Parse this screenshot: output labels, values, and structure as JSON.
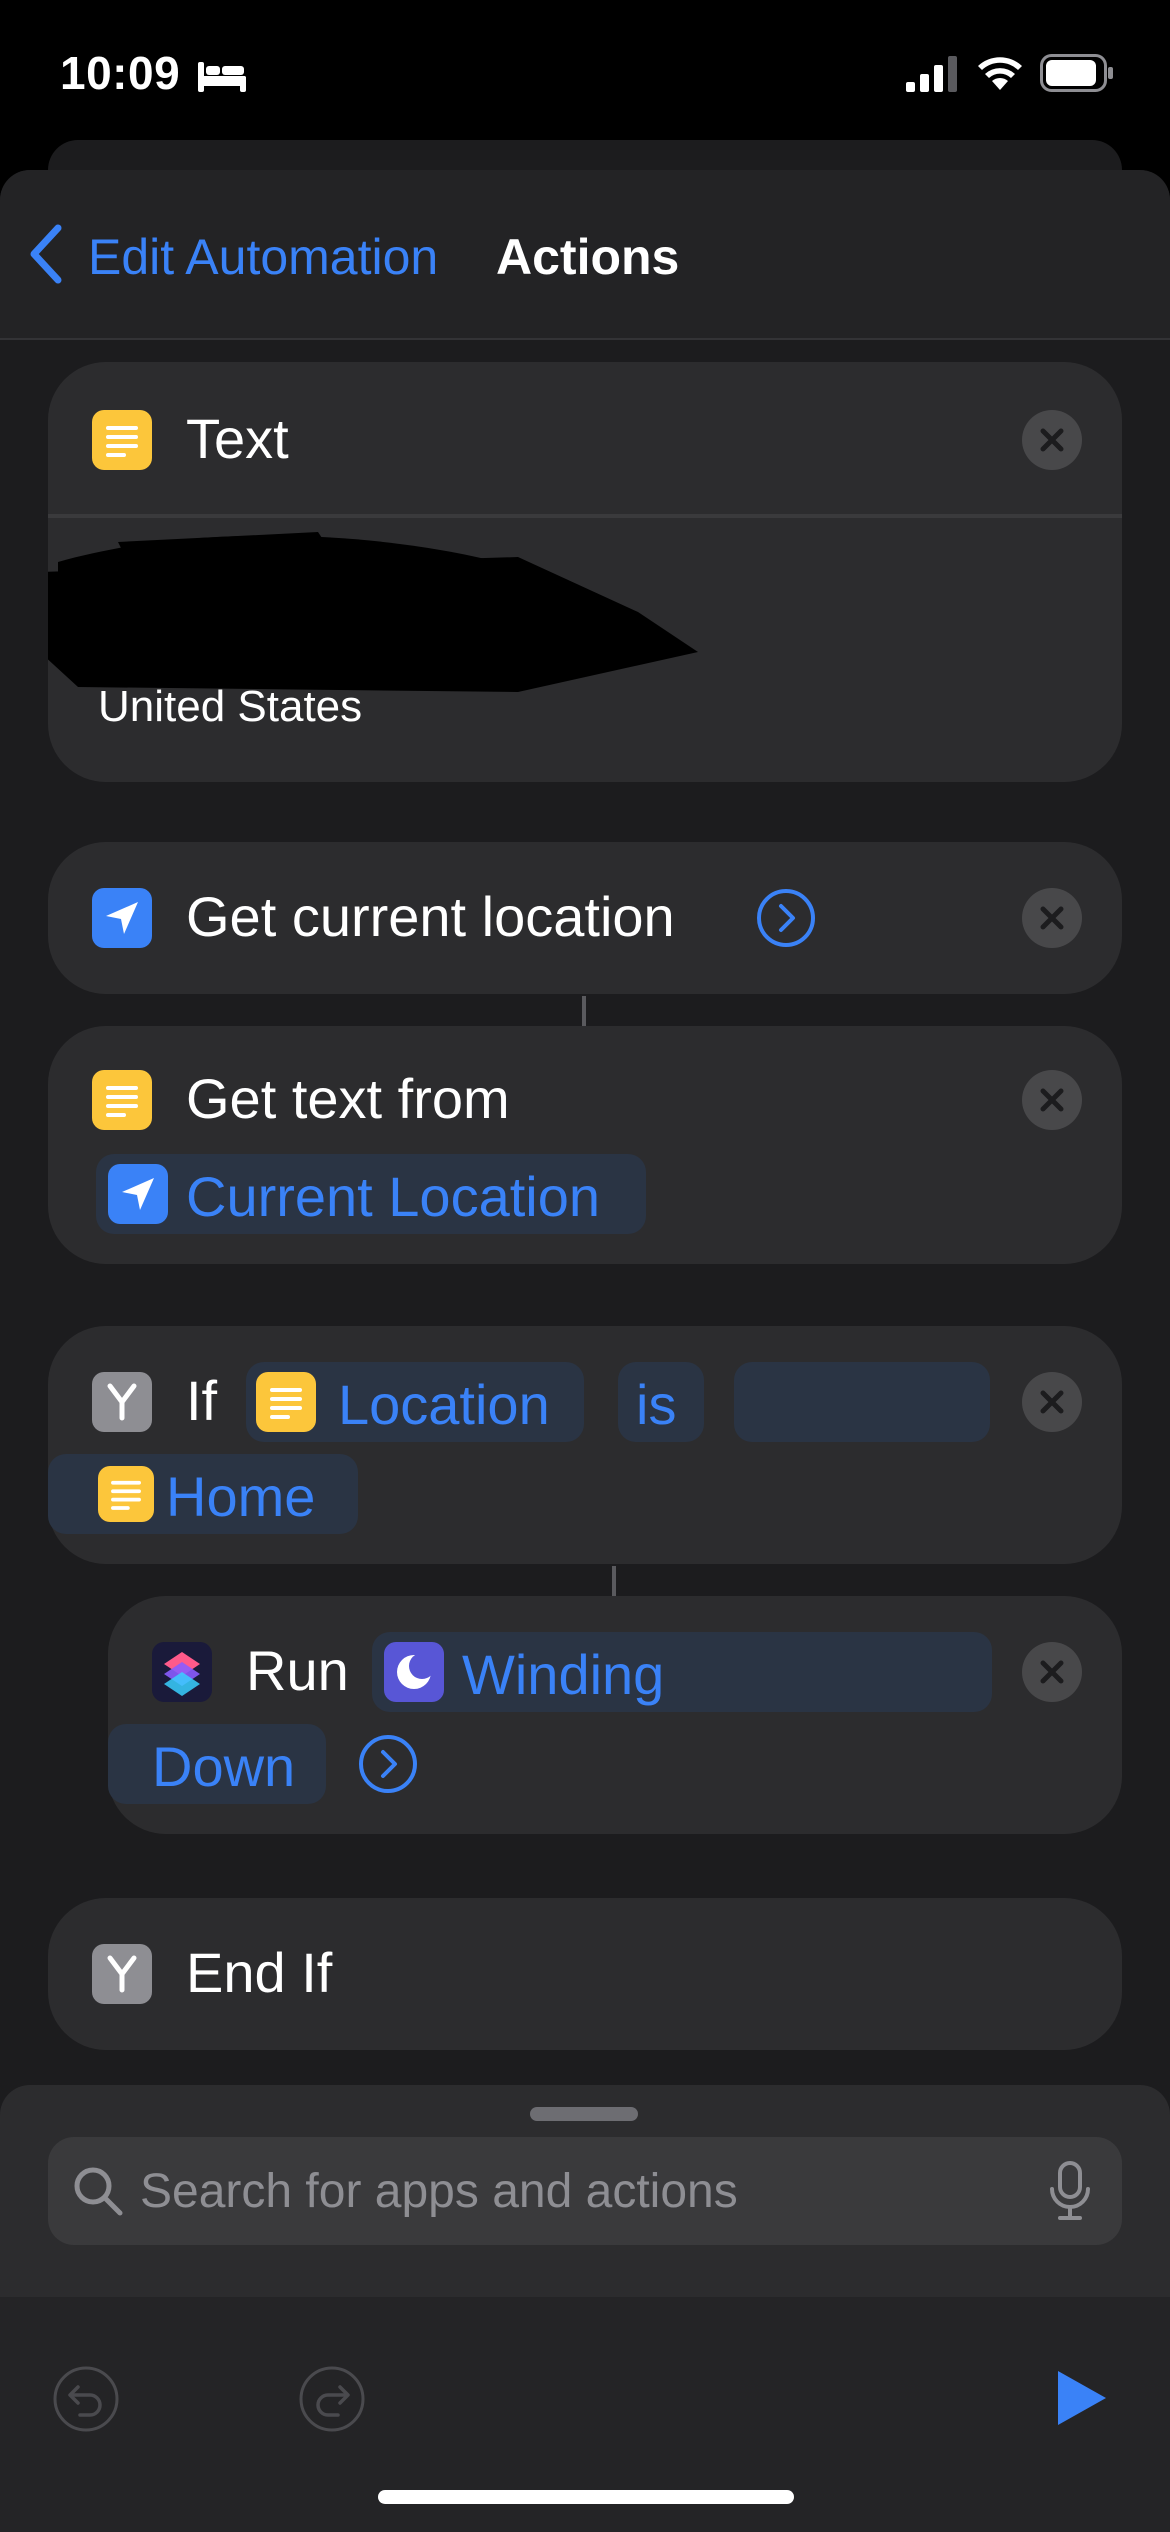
{
  "status_bar": {
    "time": "10:09"
  },
  "nav": {
    "back_label": "Edit Automation",
    "title": "Actions"
  },
  "actions": {
    "text_action": {
      "title": "Text",
      "body_visible": "United States"
    },
    "get_location": {
      "title": "Get current location"
    },
    "get_text": {
      "title": "Get text from",
      "variable": "Current Location"
    },
    "if_action": {
      "keyword": "If",
      "input_variable": "Location",
      "condition": "is",
      "value_variable": "Home"
    },
    "run_action": {
      "keyword": "Run",
      "shortcut_line1": "Winding",
      "shortcut_line2": "Down"
    },
    "end_if": {
      "title": "End If"
    }
  },
  "search": {
    "placeholder": "Search for apps and actions"
  },
  "colors": {
    "accent": "#3a82f7",
    "text_icon": "#fcc63b",
    "scripting_icon": "#8e8e93",
    "card": "#2c2c2e",
    "background": "#1c1c1e"
  },
  "icons": {
    "text_action": "text-lines-icon",
    "location": "location-arrow-icon",
    "if": "branch-icon",
    "run": "shortcuts-icon",
    "focus": "moon-icon"
  }
}
